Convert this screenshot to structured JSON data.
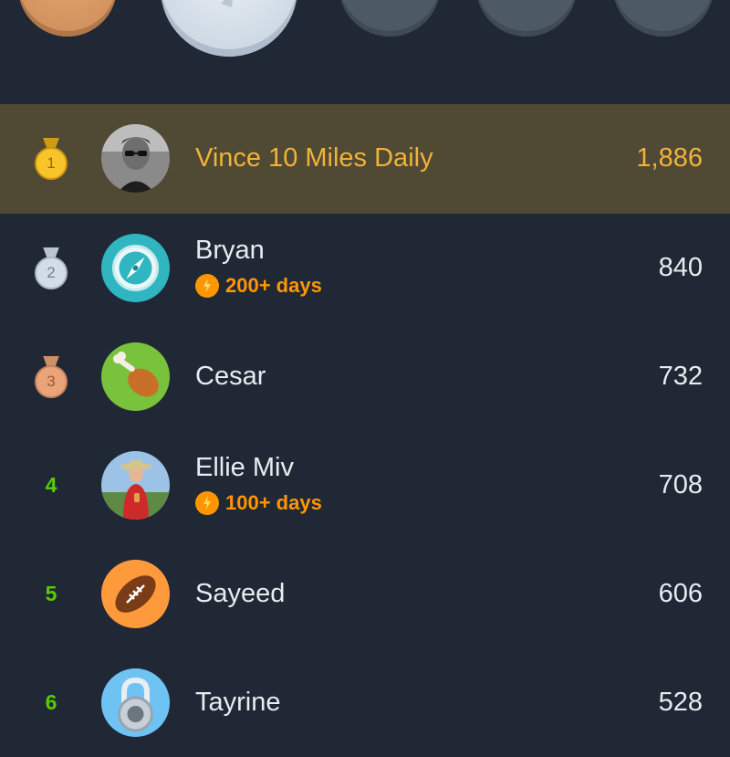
{
  "leaderboard": {
    "rows": [
      {
        "rank": "1",
        "medal": "gold-medal",
        "name": "Vince 10 Miles Daily",
        "streak": "",
        "xp": "1,886",
        "avatar": "photo-man-sunglasses"
      },
      {
        "rank": "2",
        "medal": "silver-medal",
        "name": "Bryan",
        "streak": "200+ days",
        "xp": "840",
        "avatar": "compass-avatar"
      },
      {
        "rank": "3",
        "medal": "bronze-medal",
        "name": "Cesar",
        "streak": "",
        "xp": "732",
        "avatar": "drumstick-avatar"
      },
      {
        "rank": "4",
        "medal": "",
        "name": "Ellie Miv",
        "streak": "100+ days",
        "xp": "708",
        "avatar": "photo-woman-hat"
      },
      {
        "rank": "5",
        "medal": "",
        "name": "Sayeed",
        "streak": "",
        "xp": "606",
        "avatar": "football-avatar"
      },
      {
        "rank": "6",
        "medal": "",
        "name": "Tayrine",
        "streak": "",
        "xp": "528",
        "avatar": "padlock-avatar"
      }
    ]
  },
  "colors": {
    "background": "#202836",
    "highlight_row": "#504933",
    "highlight_text": "#f0b33a",
    "rank_green": "#58cc02",
    "streak_orange": "#ff9600"
  }
}
